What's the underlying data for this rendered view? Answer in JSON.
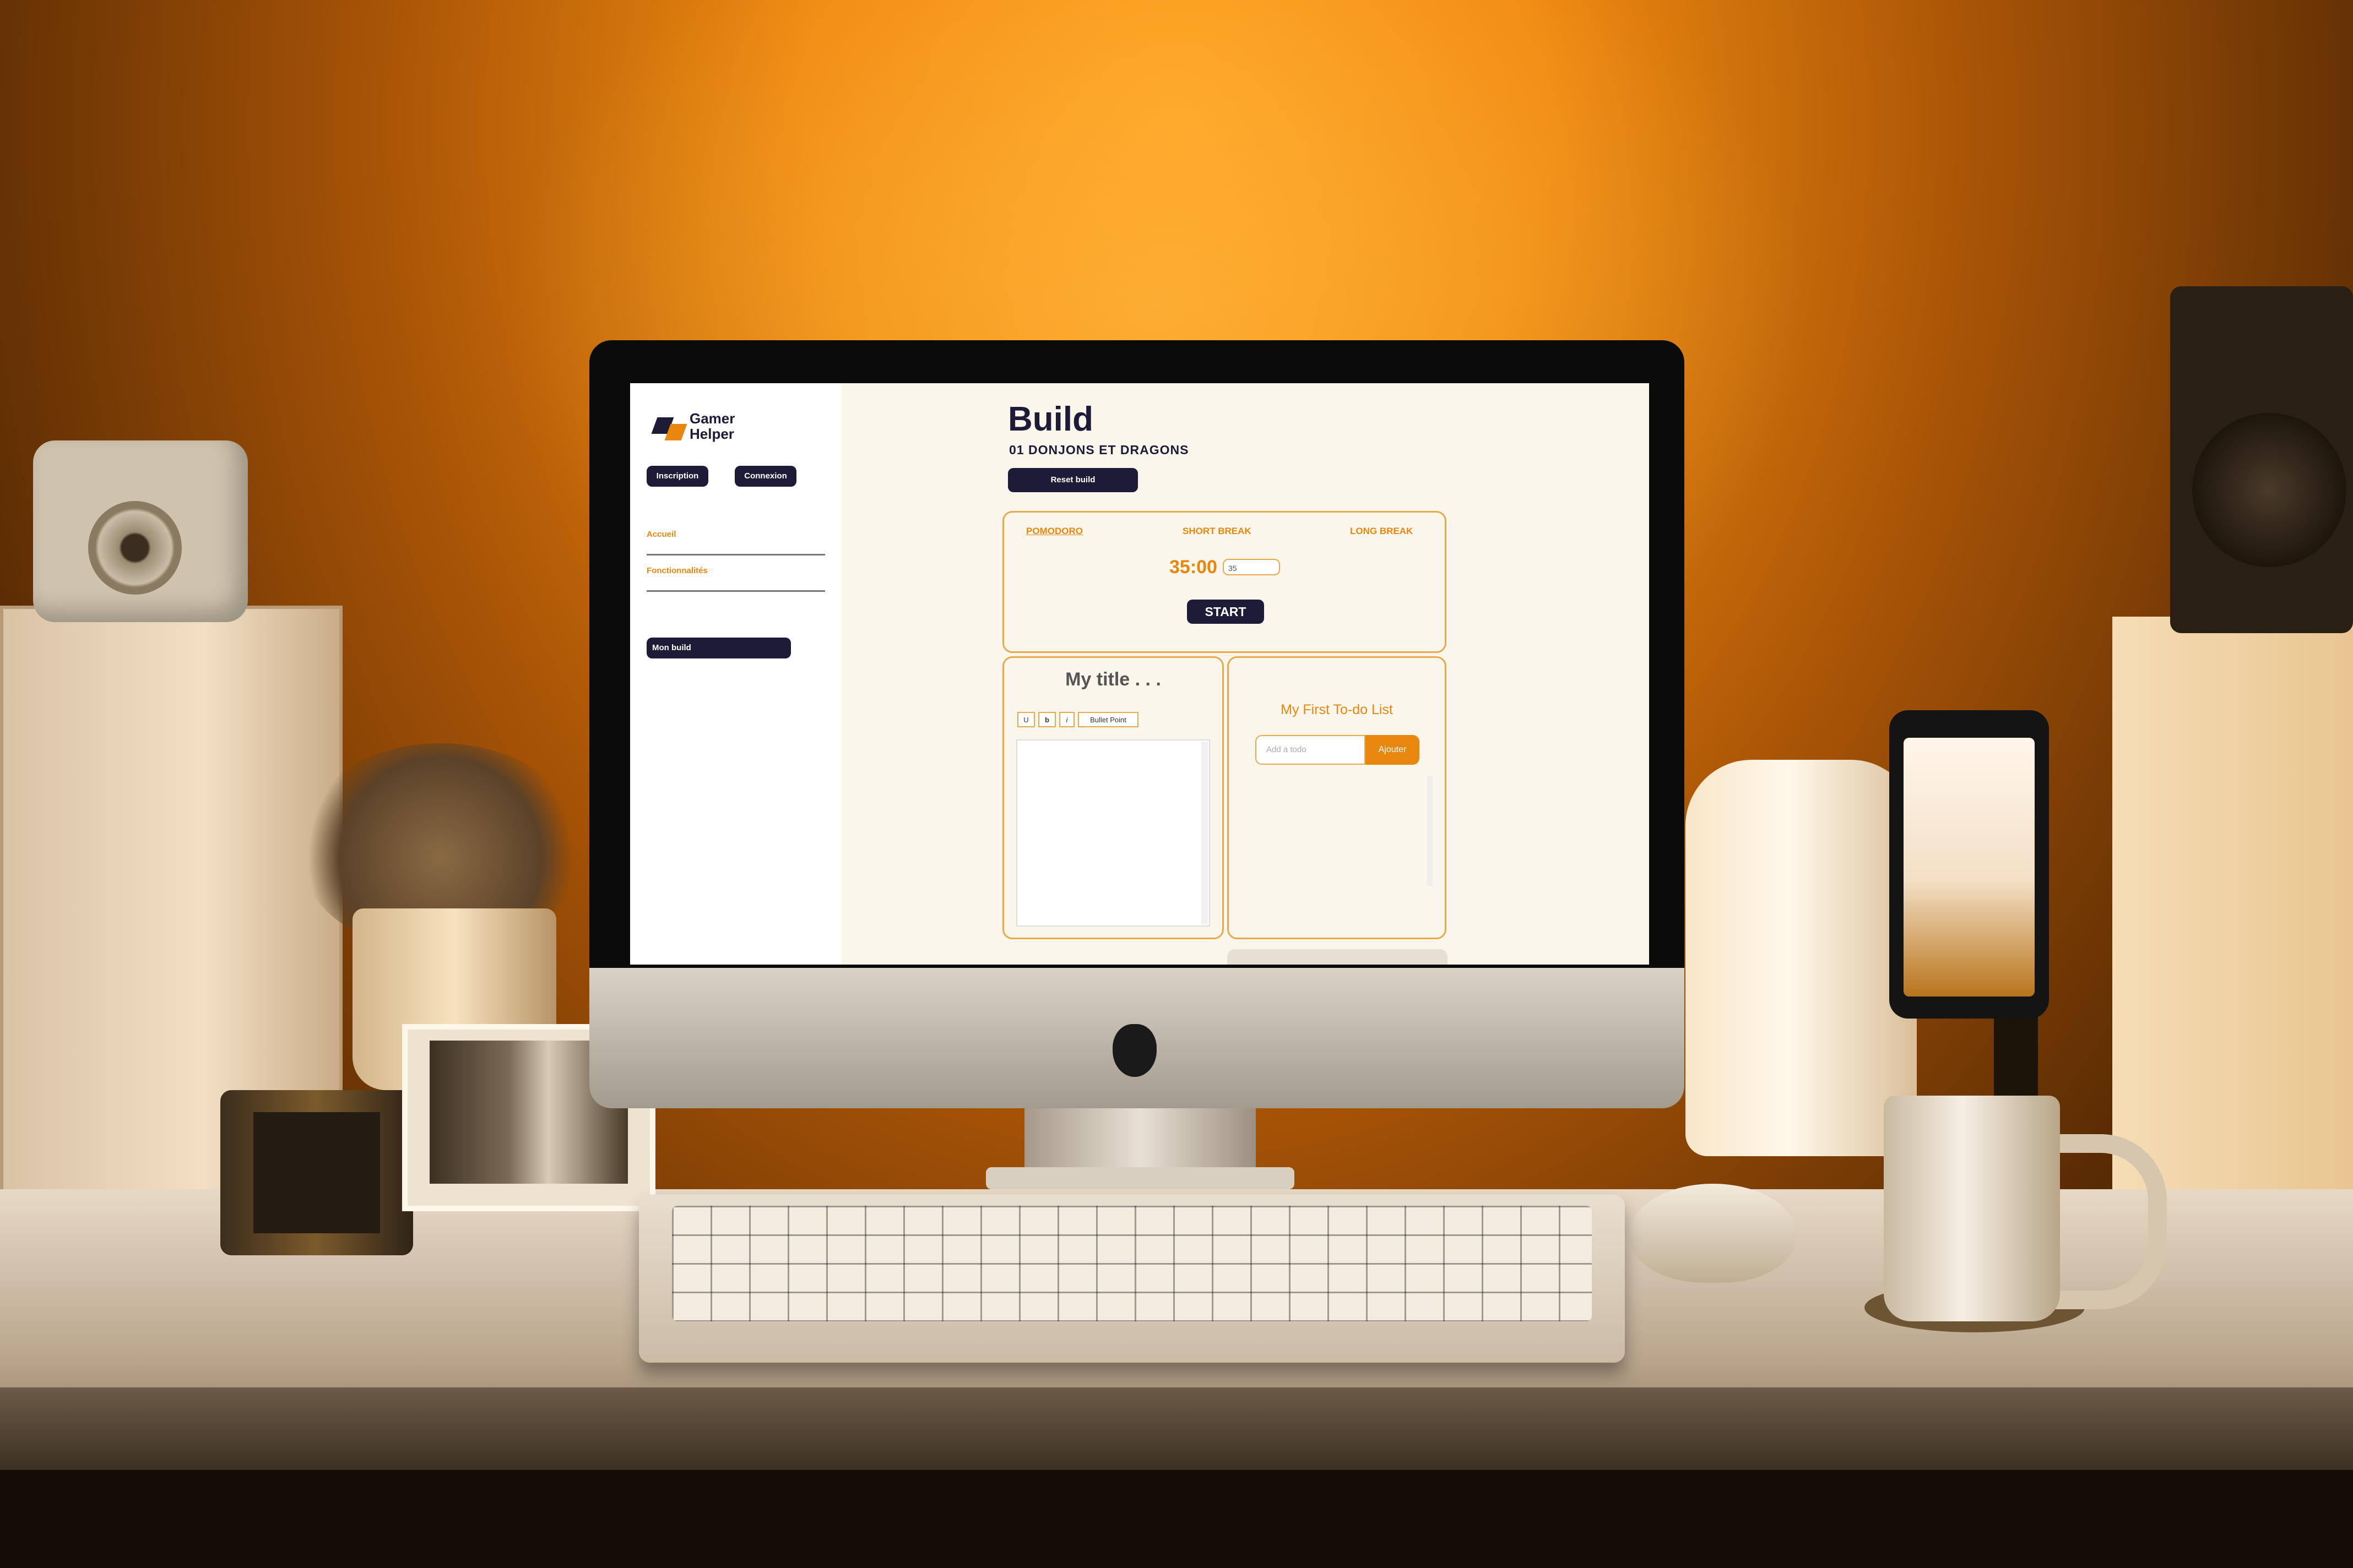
{
  "app": {
    "logo_text_1": "Gamer",
    "logo_text_2": "Helper",
    "auth": {
      "signup": "Inscription",
      "login": "Connexion"
    },
    "nav": [
      {
        "label": "Accueil"
      },
      {
        "label": "Fonctionnalités"
      }
    ],
    "my_build_button": "Mon build"
  },
  "page": {
    "title": "Build",
    "subtitle": "01 DONJONS ET DRAGONS",
    "reset_button": "Reset build"
  },
  "pomodoro": {
    "tabs": [
      {
        "label": "POMODORO",
        "active": true
      },
      {
        "label": "SHORT BREAK",
        "active": false
      },
      {
        "label": "LONG BREAK",
        "active": false
      }
    ],
    "time": "35:00",
    "minutes_input_value": "35",
    "start_label": "START"
  },
  "notes": {
    "title": "My title . . .",
    "format_buttons": [
      "U",
      "b",
      "i",
      "Bullet Point"
    ]
  },
  "todo": {
    "title": "My First To-do List",
    "input_placeholder": "Add a todo",
    "add_button": "Ajouter"
  },
  "colors": {
    "primary_dark": "#1e1b38",
    "accent_orange": "#e8870e",
    "panel_border": "#e8a94a",
    "screen_bg": "#faf6ec"
  }
}
